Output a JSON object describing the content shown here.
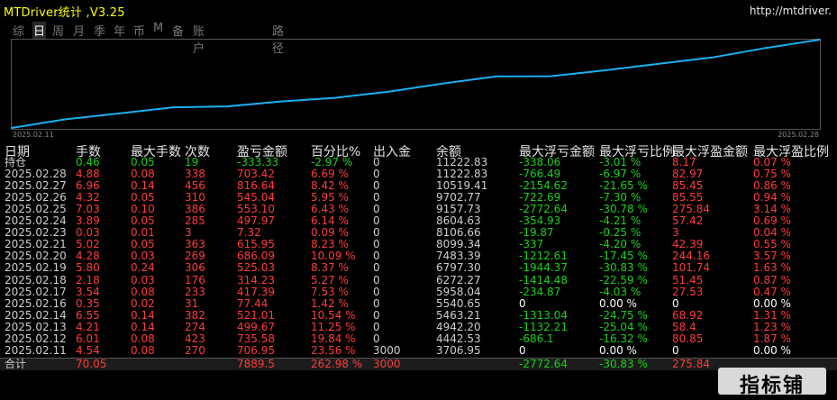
{
  "app": {
    "title": "MTDriver统计 ,V3.25",
    "url": "http://mtdriver."
  },
  "tabs": [
    {
      "label": "综",
      "active": false
    },
    {
      "label": "日",
      "active": true
    },
    {
      "label": "周",
      "active": false
    },
    {
      "label": "月",
      "active": false
    },
    {
      "label": "季",
      "active": false
    },
    {
      "label": "年",
      "active": false
    },
    {
      "label": "币",
      "active": false
    },
    {
      "label": "M",
      "active": false
    },
    {
      "label": "备",
      "active": false
    },
    {
      "label": "账户",
      "active": false
    },
    {
      "label": "路径",
      "active": false
    }
  ],
  "chart_data": {
    "type": "line",
    "title": "",
    "x_start_label": "2025.02.11",
    "x_end_label": "2025.02.28",
    "x": [
      "2025.02.11",
      "2025.02.12",
      "2025.02.13",
      "2025.02.14",
      "2025.02.16",
      "2025.02.17",
      "2025.02.18",
      "2025.02.19",
      "2025.02.20",
      "2025.02.21",
      "2025.02.23",
      "2025.02.24",
      "2025.02.25",
      "2025.02.26",
      "2025.02.27",
      "2025.02.28"
    ],
    "series": [
      {
        "values": [
          3706.95,
          4442.53,
          4942.2,
          5463.21,
          5540.65,
          5958.04,
          6272.27,
          6797.3,
          7483.39,
          8099.34,
          8106.66,
          8604.63,
          9157.73,
          9702.77,
          10519.41,
          11222.83
        ]
      }
    ],
    "line_color": "#1ab0f0",
    "grid": false
  },
  "table": {
    "headers": [
      "日期",
      "手数",
      "最大手数",
      "次数",
      "盈亏金额",
      "百分比%",
      "出入金",
      "余额",
      "最大浮亏金额",
      "最大浮亏比例",
      "最大浮盈金额",
      "最大浮盈比例"
    ],
    "rows": [
      {
        "date": "持仓",
        "lots": "0.46",
        "maxlots": "0.05",
        "count": "19",
        "pnl": "-333.33",
        "pct": "-2.97 %",
        "io": "0",
        "bal": "11222.83",
        "mfl": "-338.06",
        "mflp": "-3.01 %",
        "mfp": "8.17",
        "mfpp": "0.07 %",
        "color": "green"
      },
      {
        "date": "2025.02.28",
        "lots": "4.88",
        "maxlots": "0.08",
        "count": "338",
        "pnl": "703.42",
        "pct": "6.69 %",
        "io": "0",
        "bal": "11222.83",
        "mfl": "-766.49",
        "mflp": "-6.97 %",
        "mfp": "82.97",
        "mfpp": "0.75 %",
        "color": "red"
      },
      {
        "date": "2025.02.27",
        "lots": "6.96",
        "maxlots": "0.14",
        "count": "456",
        "pnl": "816.64",
        "pct": "8.42 %",
        "io": "0",
        "bal": "10519.41",
        "mfl": "-2154.62",
        "mflp": "-21.65 %",
        "mfp": "85.45",
        "mfpp": "0.86 %",
        "color": "red"
      },
      {
        "date": "2025.02.26",
        "lots": "4.32",
        "maxlots": "0.05",
        "count": "310",
        "pnl": "545.04",
        "pct": "5.95 %",
        "io": "0",
        "bal": "9702.77",
        "mfl": "-722.69",
        "mflp": "-7.30 %",
        "mfp": "85.55",
        "mfpp": "0.94 %",
        "color": "red"
      },
      {
        "date": "2025.02.25",
        "lots": "7.03",
        "maxlots": "0.10",
        "count": "386",
        "pnl": "553.10",
        "pct": "6.43 %",
        "io": "0",
        "bal": "9157.73",
        "mfl": "-2772.64",
        "mflp": "-30.78 %",
        "mfp": "275.84",
        "mfpp": "3.14 %",
        "color": "red"
      },
      {
        "date": "2025.02.24",
        "lots": "3.89",
        "maxlots": "0.05",
        "count": "285",
        "pnl": "497.97",
        "pct": "6.14 %",
        "io": "0",
        "bal": "8604.63",
        "mfl": "-354.93",
        "mflp": "-4.21 %",
        "mfp": "57.42",
        "mfpp": "0.69 %",
        "color": "red"
      },
      {
        "date": "2025.02.23",
        "lots": "0.03",
        "maxlots": "0.01",
        "count": "3",
        "pnl": "7.32",
        "pct": "0.09 %",
        "io": "0",
        "bal": "8106.66",
        "mfl": "-19.87",
        "mflp": "-0.25 %",
        "mfp": "3",
        "mfpp": "0.04 %",
        "color": "red"
      },
      {
        "date": "2025.02.21",
        "lots": "5.02",
        "maxlots": "0.05",
        "count": "363",
        "pnl": "615.95",
        "pct": "8.23 %",
        "io": "0",
        "bal": "8099.34",
        "mfl": "-337",
        "mflp": "-4.20 %",
        "mfp": "42.39",
        "mfpp": "0.55 %",
        "color": "red"
      },
      {
        "date": "2025.02.20",
        "lots": "4.28",
        "maxlots": "0.03",
        "count": "269",
        "pnl": "686.09",
        "pct": "10.09 %",
        "io": "0",
        "bal": "7483.39",
        "mfl": "-1212.61",
        "mflp": "-17.45 %",
        "mfp": "244.16",
        "mfpp": "3.57 %",
        "color": "red"
      },
      {
        "date": "2025.02.19",
        "lots": "5.80",
        "maxlots": "0.24",
        "count": "306",
        "pnl": "525.03",
        "pct": "8.37 %",
        "io": "0",
        "bal": "6797.30",
        "mfl": "-1944.37",
        "mflp": "-30.83 %",
        "mfp": "101.74",
        "mfpp": "1.63 %",
        "color": "red"
      },
      {
        "date": "2025.02.18",
        "lots": "2.18",
        "maxlots": "0.03",
        "count": "176",
        "pnl": "314.23",
        "pct": "5.27 %",
        "io": "0",
        "bal": "6272.27",
        "mfl": "-1414.48",
        "mflp": "-22.59 %",
        "mfp": "51.45",
        "mfpp": "0.87 %",
        "color": "red"
      },
      {
        "date": "2025.02.17",
        "lots": "3.54",
        "maxlots": "0.08",
        "count": "233",
        "pnl": "417.39",
        "pct": "7.53 %",
        "io": "0",
        "bal": "5958.04",
        "mfl": "-234.87",
        "mflp": "-4.03 %",
        "mfp": "27.53",
        "mfpp": "0.47 %",
        "color": "red"
      },
      {
        "date": "2025.02.16",
        "lots": "0.35",
        "maxlots": "0.02",
        "count": "31",
        "pnl": "77.44",
        "pct": "1.42 %",
        "io": "0",
        "bal": "5540.65",
        "mfl": "0",
        "mflp": "0.00 %",
        "mfp": "0",
        "mfpp": "0.00 %",
        "color": "red"
      },
      {
        "date": "2025.02.14",
        "lots": "6.55",
        "maxlots": "0.14",
        "count": "382",
        "pnl": "521.01",
        "pct": "10.54 %",
        "io": "0",
        "bal": "5463.21",
        "mfl": "-1313.04",
        "mflp": "-24.75 %",
        "mfp": "68.92",
        "mfpp": "1.31 %",
        "color": "red"
      },
      {
        "date": "2025.02.13",
        "lots": "4.21",
        "maxlots": "0.14",
        "count": "274",
        "pnl": "499.67",
        "pct": "11.25 %",
        "io": "0",
        "bal": "4942.20",
        "mfl": "-1132.21",
        "mflp": "-25.04 %",
        "mfp": "58.4",
        "mfpp": "1.23 %",
        "color": "red"
      },
      {
        "date": "2025.02.12",
        "lots": "6.01",
        "maxlots": "0.08",
        "count": "423",
        "pnl": "735.58",
        "pct": "19.84 %",
        "io": "0",
        "bal": "4442.53",
        "mfl": "-686.1",
        "mflp": "-16.32 %",
        "mfp": "80.85",
        "mfpp": "1.87 %",
        "color": "red"
      },
      {
        "date": "2025.02.11",
        "lots": "4.54",
        "maxlots": "0.08",
        "count": "270",
        "pnl": "706.95",
        "pct": "23.56 %",
        "io": "3000",
        "bal": "3706.95",
        "mfl": "0",
        "mflp": "0.00 %",
        "mfp": "0",
        "mfpp": "0.00 %",
        "color": "red"
      }
    ],
    "total": {
      "date": "合计",
      "lots": "70.05",
      "maxlots": "",
      "count": "",
      "pnl": "7889.5",
      "pct": "262.98 %",
      "io": "3000",
      "bal": "",
      "mfl": "-2772.64",
      "mflp": "-30.83 %",
      "mfp": "275.84",
      "mfpp": ""
    }
  },
  "watermark": "指标铺",
  "colors": {
    "red": "#ff3b3b",
    "green": "#19d119",
    "gray": "#cfcfcf",
    "white": "#ffffff"
  }
}
